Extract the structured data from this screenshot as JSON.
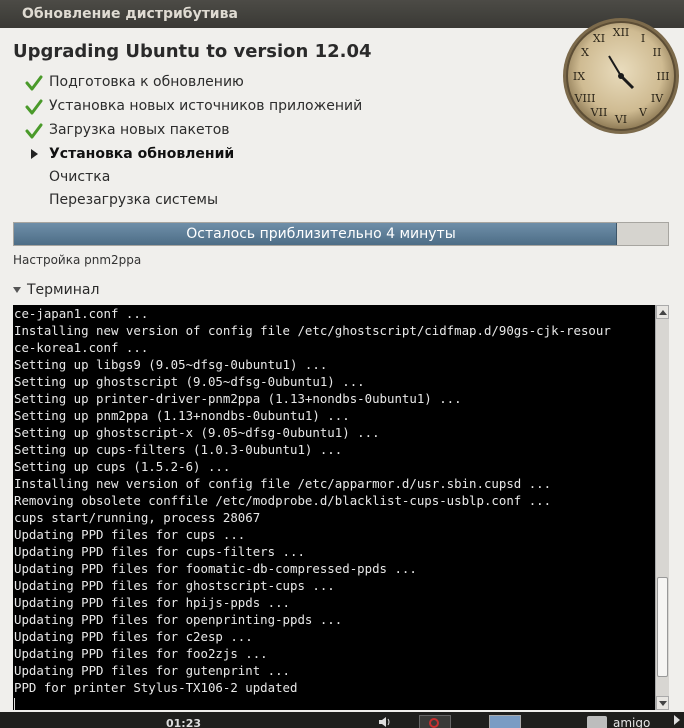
{
  "window": {
    "title": "Обновление дистрибутива"
  },
  "heading": "Upgrading Ubuntu to version 12.04",
  "steps": [
    {
      "label": "Подготовка к обновлению",
      "state": "done"
    },
    {
      "label": "Установка новых источников приложений",
      "state": "done"
    },
    {
      "label": "Загрузка новых пакетов",
      "state": "done"
    },
    {
      "label": "Установка обновлений",
      "state": "active"
    },
    {
      "label": "Очистка",
      "state": "pending"
    },
    {
      "label": "Перезагрузка системы",
      "state": "pending"
    }
  ],
  "icons": {
    "done": "checkmark-icon",
    "active": "triangle-right-icon",
    "clock": "clock-icon"
  },
  "progress": {
    "label": "Осталось приблизительно 4 минуты",
    "fraction": 0.92
  },
  "status": "Настройка pnm2ppa",
  "terminal": {
    "expander_label": "Терминал",
    "lines": [
      "ce-japan1.conf ...",
      "Installing new version of config file /etc/ghostscript/cidfmap.d/90gs-cjk-resour",
      "ce-korea1.conf ...",
      "Setting up libgs9 (9.05~dfsg-0ubuntu1) ...",
      "Setting up ghostscript (9.05~dfsg-0ubuntu1) ...",
      "Setting up printer-driver-pnm2ppa (1.13+nondbs-0ubuntu1) ...",
      "Setting up pnm2ppa (1.13+nondbs-0ubuntu1) ...",
      "Setting up ghostscript-x (9.05~dfsg-0ubuntu1) ...",
      "Setting up cups-filters (1.0.3-0ubuntu1) ...",
      "Setting up cups (1.5.2-6) ...",
      "Installing new version of config file /etc/apparmor.d/usr.sbin.cupsd ...",
      "Removing obsolete conffile /etc/modprobe.d/blacklist-cups-usblp.conf ...",
      "cups start/running, process 28067",
      "Updating PPD files for cups ...",
      "Updating PPD files for cups-filters ...",
      "Updating PPD files for foomatic-db-compressed-ppds ...",
      "Updating PPD files for ghostscript-cups ...",
      "Updating PPD files for hpijs-ppds ...",
      "Updating PPD files for openprinting-ppds ...",
      "Updating PPD files for c2esp ...",
      "Updating PPD files for foo2zjs ...",
      "Updating PPD files for gutenprint ...",
      "PPD for printer Stylus-TX106-2 updated",
      ""
    ],
    "scroll_position": 0.93
  },
  "taskbar": {
    "clock": "01:23",
    "user": "amigo"
  },
  "colors": {
    "check": "#4a9a2a",
    "progress": "#5a7a94",
    "terminal_bg": "#000000"
  }
}
